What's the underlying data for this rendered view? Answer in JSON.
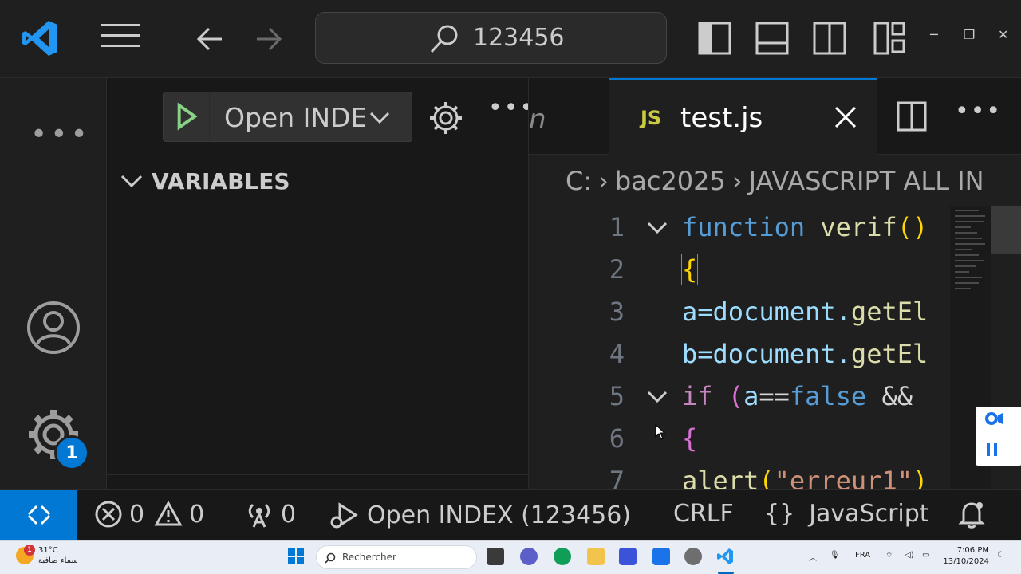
{
  "titlebar": {
    "search_text": "123456"
  },
  "activity": {
    "settings_badge": "1"
  },
  "sidebar": {
    "run_config_label": "Open INDEX",
    "variables_header": "VARIABLES"
  },
  "editor": {
    "prev_tab_fragment": "n",
    "active_tab": {
      "icon_text": "JS",
      "name": "test.js"
    },
    "breadcrumb": [
      "C:",
      "bac2025",
      "JAVASCRIPT ALL IN"
    ],
    "lines": [
      {
        "num": "1",
        "fold": true
      },
      {
        "num": "2",
        "fold": false
      },
      {
        "num": "3",
        "fold": false
      },
      {
        "num": "4",
        "fold": false
      },
      {
        "num": "5",
        "fold": true
      },
      {
        "num": "6",
        "fold": false
      },
      {
        "num": "7",
        "fold": false
      }
    ],
    "code_text": {
      "l1_kw": "function",
      "l1_fn": "verif",
      "l1_paren": "()",
      "l2": "{",
      "l3_var": "a",
      "l3_rest": "=document.",
      "l3_fn": "getEl",
      "l4_var": "b",
      "l4_rest": "=document.",
      "l4_fn": "getEl",
      "l5_kw": "if",
      "l5_paren": "(",
      "l5_var": "a",
      "l5_eq": "==",
      "l5_false": "false",
      "l5_and": " &&",
      "l6": "{",
      "l7_fn": "alert",
      "l7_paren": "(",
      "l7_str": "\"erreur1\"",
      "l7_close": ")"
    }
  },
  "statusbar": {
    "errors": "0",
    "warnings": "0",
    "ports": "0",
    "run_status": "Open INDEX (123456)",
    "eol": "CRLF",
    "language": "JavaScript"
  },
  "taskbar": {
    "temperature": "31°C",
    "weather_desc": "سماء صافية",
    "weather_alert": "1",
    "search_label": "Rechercher",
    "lang": "FRA",
    "time": "7:06 PM",
    "date": "13/10/2024"
  },
  "colors": {
    "accent": "#0078d4",
    "keyword": "#569cd6",
    "control_keyword": "#c586c0",
    "function": "#dcdcaa",
    "variable": "#9cdcfe",
    "string": "#ce9178"
  }
}
